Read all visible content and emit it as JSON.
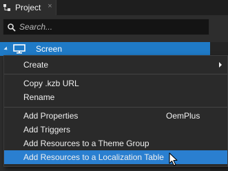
{
  "tab": {
    "title": "Project",
    "close_glyph": "×"
  },
  "search": {
    "placeholder": "Search..."
  },
  "tree": {
    "root_label": "Screen"
  },
  "menu": {
    "items": [
      {
        "label": "Create",
        "shortcut": "",
        "has_submenu": true
      },
      {
        "label": "Copy .kzb URL",
        "shortcut": ""
      },
      {
        "label": "Rename",
        "shortcut": ""
      },
      {
        "label": "Add Properties",
        "shortcut": "OemPlus"
      },
      {
        "label": "Add Triggers",
        "shortcut": ""
      },
      {
        "label": "Add Resources to a Theme Group",
        "shortcut": ""
      },
      {
        "label": "Add Resources to a Localization Table",
        "shortcut": ""
      }
    ],
    "highlighted_item": "Add Resources to a Localization Table"
  },
  "colors": {
    "accent": "#1f7ac6",
    "highlight": "#2a7fd0",
    "panel": "#2d2d2d",
    "background": "#1b1b1b"
  },
  "icons": [
    "project-icon",
    "tab-close-icon",
    "search-icon",
    "expand-arrow-icon",
    "screen-icon",
    "submenu-arrow-icon",
    "mouse-cursor-icon"
  ]
}
